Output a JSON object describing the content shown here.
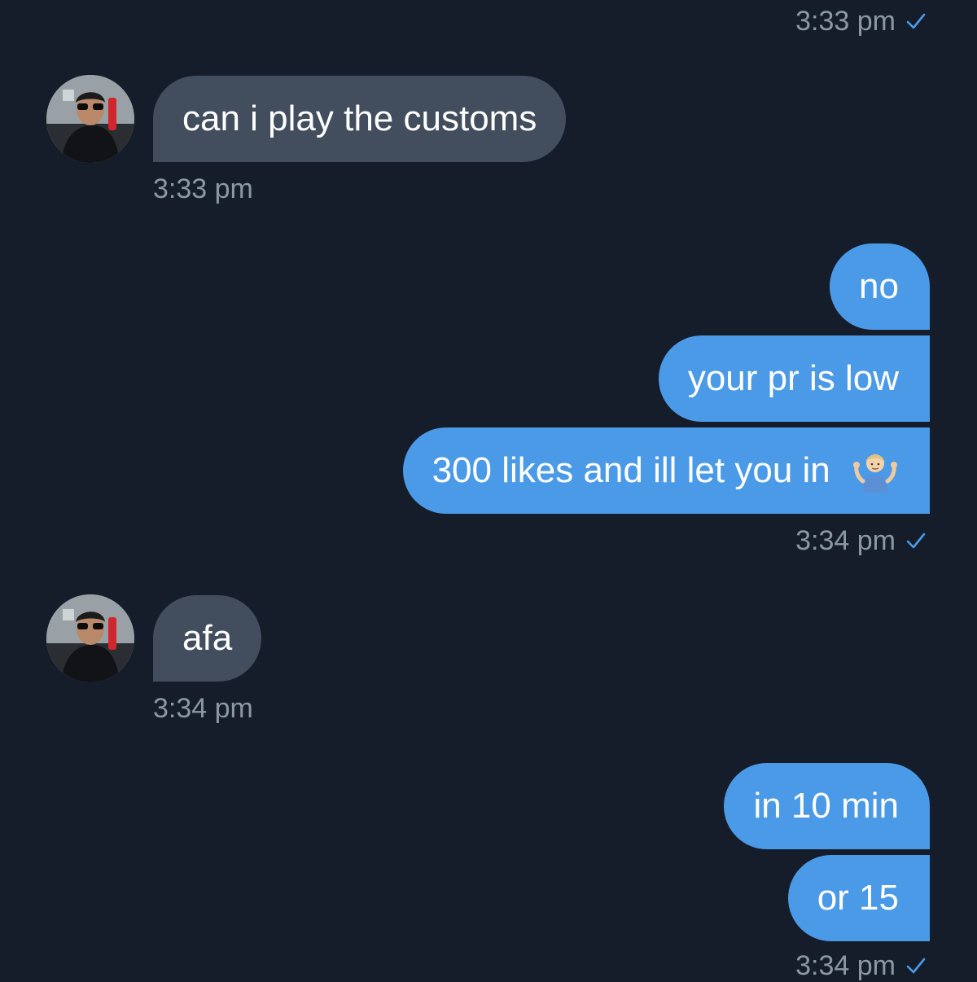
{
  "conversation": {
    "messages": [
      {
        "kind": "timestamp_out",
        "time": "3:33 pm"
      },
      {
        "kind": "in",
        "text": "can i play the customs",
        "time": "3:33 pm"
      },
      {
        "kind": "out",
        "text": "no"
      },
      {
        "kind": "out",
        "text": "your pr is low"
      },
      {
        "kind": "out",
        "text": "300 likes and ill let you in",
        "emoji": "person-shrugging-emoji",
        "time": "3:34 pm"
      },
      {
        "kind": "in",
        "text": "afa",
        "time": "3:34 pm"
      },
      {
        "kind": "out",
        "text": "in 10 min"
      },
      {
        "kind": "out",
        "text": "or 15",
        "time": "3:34 pm"
      }
    ]
  },
  "colors": {
    "background": "#151d2a",
    "incoming_bubble": "#424e5e",
    "outgoing_bubble": "#4b9ae8",
    "timestamp": "#8b98a5",
    "read_check": "#4b9ae8"
  },
  "icons": {
    "read_receipt": "checkmark-icon",
    "avatar": "contact-avatar"
  }
}
